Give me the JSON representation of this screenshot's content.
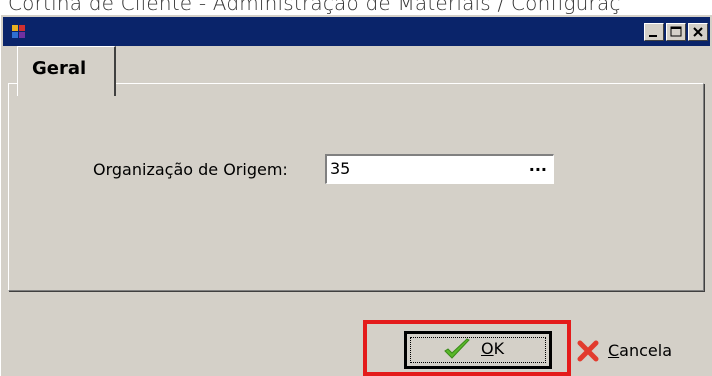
{
  "caption": {
    "text": "Cortina de Cliente - Administração de Materiais / Configuraç"
  },
  "window": {
    "title": "",
    "controls": {
      "minimize": "minimize-icon",
      "maximize": "maximize-icon",
      "close": "close-icon"
    }
  },
  "tabs": [
    {
      "label": "Geral",
      "active": true
    }
  ],
  "form": {
    "origin_label": "Organização de Origem:",
    "origin_value": "35",
    "lookup_label": "..."
  },
  "buttons": {
    "ok": {
      "mnemonic": "O",
      "rest": "K",
      "icon": "checkmark-icon"
    },
    "cancel": {
      "mnemonic": "C",
      "rest": "ancela",
      "icon": "x-icon"
    }
  },
  "colors": {
    "titlebar": "#0a246a",
    "face": "#d4d0c8",
    "highlight": "#e41b1b",
    "ok_icon": "#5ab82a",
    "cancel_icon": "#e23b2e"
  }
}
